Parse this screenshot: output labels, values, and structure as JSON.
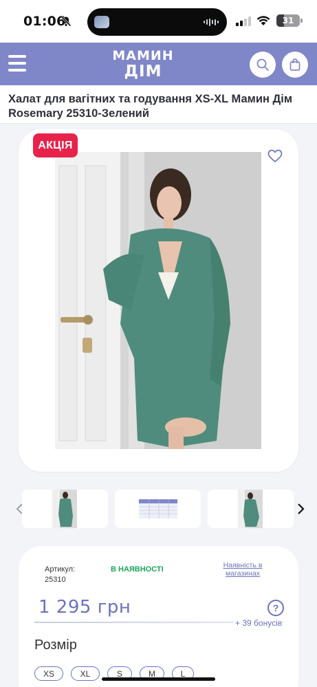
{
  "status_bar": {
    "time": "01:06",
    "battery": "31",
    "battery_level": 0.31,
    "icons": [
      "bell-slash-icon",
      "signal-icon",
      "wifi-icon",
      "battery-icon"
    ]
  },
  "header": {
    "logo_line1": "МАМИН",
    "logo_line2": "ДІМ",
    "bg_color": "#7f87c9",
    "icons": [
      "menu-icon",
      "search-icon",
      "shopping-bag-icon"
    ]
  },
  "product": {
    "title": "Халат для вагітних та годування XS-XL Мамин Дім Rosemary 25310-Зелений",
    "badge": "АКЦІЯ",
    "badge_color": "#e7234c",
    "article_label": "Артикул:",
    "article_value": "25310",
    "stock": "В НАЯВНОСТІ",
    "stock_color": "#18a65a",
    "stores_link": "Наявність в магазинах",
    "price": "1 295 грн",
    "help": "?",
    "bonus": "+ 39 бонусів",
    "size_label": "Розмір",
    "sizes": [
      "XS",
      "XL",
      "S",
      "M",
      "L"
    ],
    "accent_color": "#6a72c0"
  },
  "gallery": {
    "thumbnails": [
      "photo",
      "size-table",
      "photo"
    ]
  }
}
